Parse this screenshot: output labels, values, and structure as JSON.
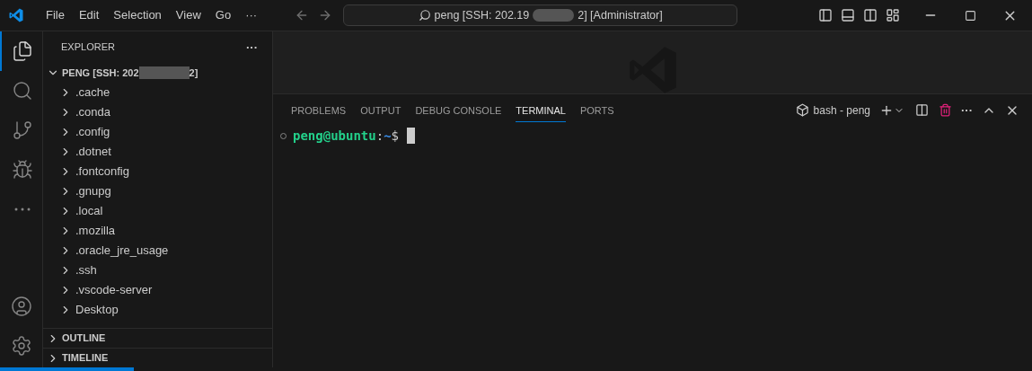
{
  "menu": [
    "File",
    "Edit",
    "Selection",
    "View",
    "Go",
    "···"
  ],
  "command_center": {
    "before": "peng [SSH: 202.19",
    "after": "2] [Administrator]"
  },
  "activity_bar": [
    {
      "kind": "files",
      "selected": true
    },
    {
      "kind": "search",
      "selected": false
    },
    {
      "kind": "git",
      "selected": false
    },
    {
      "kind": "debug",
      "selected": false
    },
    {
      "kind": "more",
      "selected": false
    }
  ],
  "sidebar": {
    "title": "EXPLORER",
    "more": "···",
    "root": {
      "before": "PENG [SSH: 202",
      "after": "2]",
      "expanded": true
    },
    "items": [
      ".cache",
      ".conda",
      ".config",
      ".dotnet",
      ".fontconfig",
      ".gnupg",
      ".local",
      ".mozilla",
      ".oracle_jre_usage",
      ".ssh",
      ".vscode-server",
      "Desktop"
    ],
    "sections": [
      {
        "label": "OUTLINE",
        "expanded": false
      },
      {
        "label": "TIMELINE",
        "expanded": false
      }
    ]
  },
  "panel": {
    "tabs": [
      {
        "label": "PROBLEMS",
        "selected": false
      },
      {
        "label": "OUTPUT",
        "selected": false
      },
      {
        "label": "DEBUG CONSOLE",
        "selected": false
      },
      {
        "label": "TERMINAL",
        "selected": true
      },
      {
        "label": "PORTS",
        "selected": false
      }
    ],
    "terminal_name": "bash - peng",
    "more": "···",
    "prompt": {
      "user_host": "peng@ubuntu",
      "sep": ":",
      "path": "~",
      "symbol": "$"
    }
  },
  "progress": {
    "level": 0.13
  }
}
